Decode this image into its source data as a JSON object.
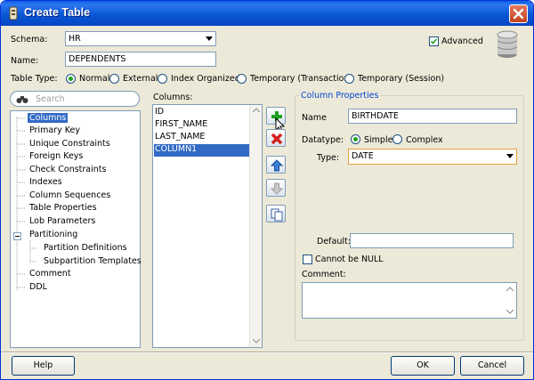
{
  "window": {
    "title": "Create Table"
  },
  "form": {
    "schema_label": "Schema:",
    "schema_value": "HR",
    "name_label": "Name:",
    "name_value": "DEPENDENTS",
    "advanced_label": "Advanced",
    "advanced_checked": true,
    "table_type_label": "Table Type:",
    "table_types": [
      "Normal",
      "External",
      "Index Organized",
      "Temporary (Transaction)",
      "Temporary (Session)"
    ],
    "table_type_selected": "Normal"
  },
  "search": {
    "placeholder": "Search"
  },
  "tree": {
    "items": [
      "Columns",
      "Primary Key",
      "Unique Constraints",
      "Foreign Keys",
      "Check Constraints",
      "Indexes",
      "Column Sequences",
      "Table Properties",
      "Lob Parameters",
      "Partitioning",
      "Partition Definitions",
      "Subpartition Templates",
      "Comment",
      "DDL"
    ],
    "selected": "Columns"
  },
  "columns": {
    "label": "Columns:",
    "items": [
      "ID",
      "FIRST_NAME",
      "LAST_NAME",
      "COLUMN1"
    ],
    "selected": "COLUMN1"
  },
  "column_properties": {
    "legend": "Column Properties",
    "name_label": "Name",
    "name_value": "BIRTHDATE",
    "datatype_label": "Datatype:",
    "datatype_options": [
      "Simple",
      "Complex"
    ],
    "datatype_selected": "Simple",
    "type_label": "Type:",
    "type_value": "DATE",
    "default_label": "Default:",
    "default_value": "",
    "not_null_label": "Cannot be NULL",
    "not_null_checked": false,
    "comment_label": "Comment:",
    "comment_value": ""
  },
  "buttons": {
    "help": "Help",
    "ok": "OK",
    "cancel": "Cancel"
  },
  "colors": {
    "accent": "#316ac5",
    "titlebar": "#0a57d6",
    "add": "#21a121",
    "remove": "#d42020"
  }
}
